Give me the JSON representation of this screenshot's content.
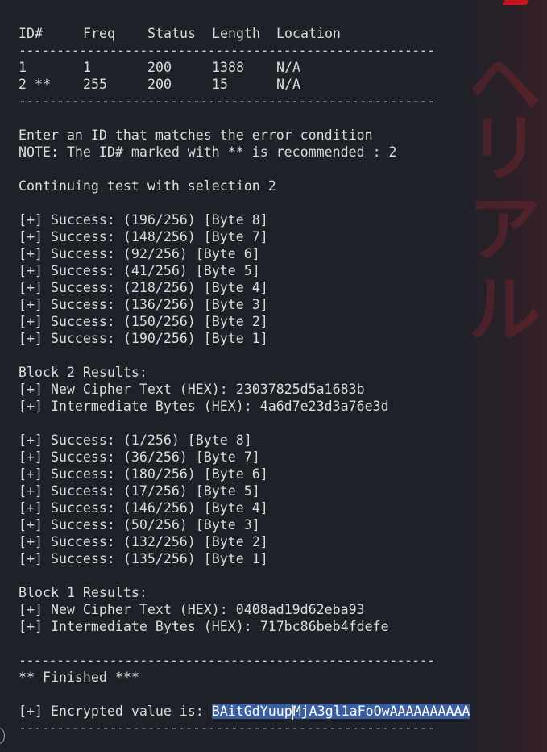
{
  "table": {
    "headers": [
      "ID#",
      "Freq",
      "Status",
      "Length",
      "Location"
    ],
    "separator": "-------------------------------------------------------",
    "rows": [
      [
        "1",
        "1",
        "200",
        "1388",
        "N/A"
      ],
      [
        "2 **",
        "255",
        "200",
        "15",
        "N/A"
      ]
    ]
  },
  "prompt": {
    "enter": "Enter an ID that matches the error condition",
    "note": "NOTE: The ID# marked with ** is recommended : 2",
    "continuing": "Continuing test with selection 2"
  },
  "block2_successes": [
    "[+] Success: (196/256) [Byte 8]",
    "[+] Success: (148/256) [Byte 7]",
    "[+] Success: (92/256) [Byte 6]",
    "[+] Success: (41/256) [Byte 5]",
    "[+] Success: (218/256) [Byte 4]",
    "[+] Success: (136/256) [Byte 3]",
    "[+] Success: (150/256) [Byte 2]",
    "[+] Success: (190/256) [Byte 1]"
  ],
  "block2": {
    "heading": "Block 2 Results:",
    "cipher": "[+] New Cipher Text (HEX): 23037825d5a1683b",
    "intermediate": "[+] Intermediate Bytes (HEX): 4a6d7e23d3a76e3d"
  },
  "block1_successes": [
    "[+] Success: (1/256) [Byte 8]",
    "[+] Success: (36/256) [Byte 7]",
    "[+] Success: (180/256) [Byte 6]",
    "[+] Success: (17/256) [Byte 5]",
    "[+] Success: (146/256) [Byte 4]",
    "[+] Success: (50/256) [Byte 3]",
    "[+] Success: (132/256) [Byte 2]",
    "[+] Success: (135/256) [Byte 1]"
  ],
  "block1": {
    "heading": "Block 1 Results:",
    "cipher": "[+] New Cipher Text (HEX): 0408ad19d62eba93",
    "intermediate": "[+] Intermediate Bytes (HEX): 717bc86beb4fdefe"
  },
  "finish": {
    "separator": "-------------------------------------------------------",
    "finished": "** Finished ***",
    "encrypted_label": "[+] Encrypted value is: ",
    "encrypted_value_a": "BAitGdYuup",
    "encrypted_value_b": "MjA3gl1aFoOwAAAAAAAAAA",
    "bottom_separator": "-------------------------------------------------------"
  },
  "theme": {
    "background": "#1f2129",
    "text": "#dcdcdc",
    "selection": "#3b5e9e",
    "accent_red": "#c8161e"
  }
}
